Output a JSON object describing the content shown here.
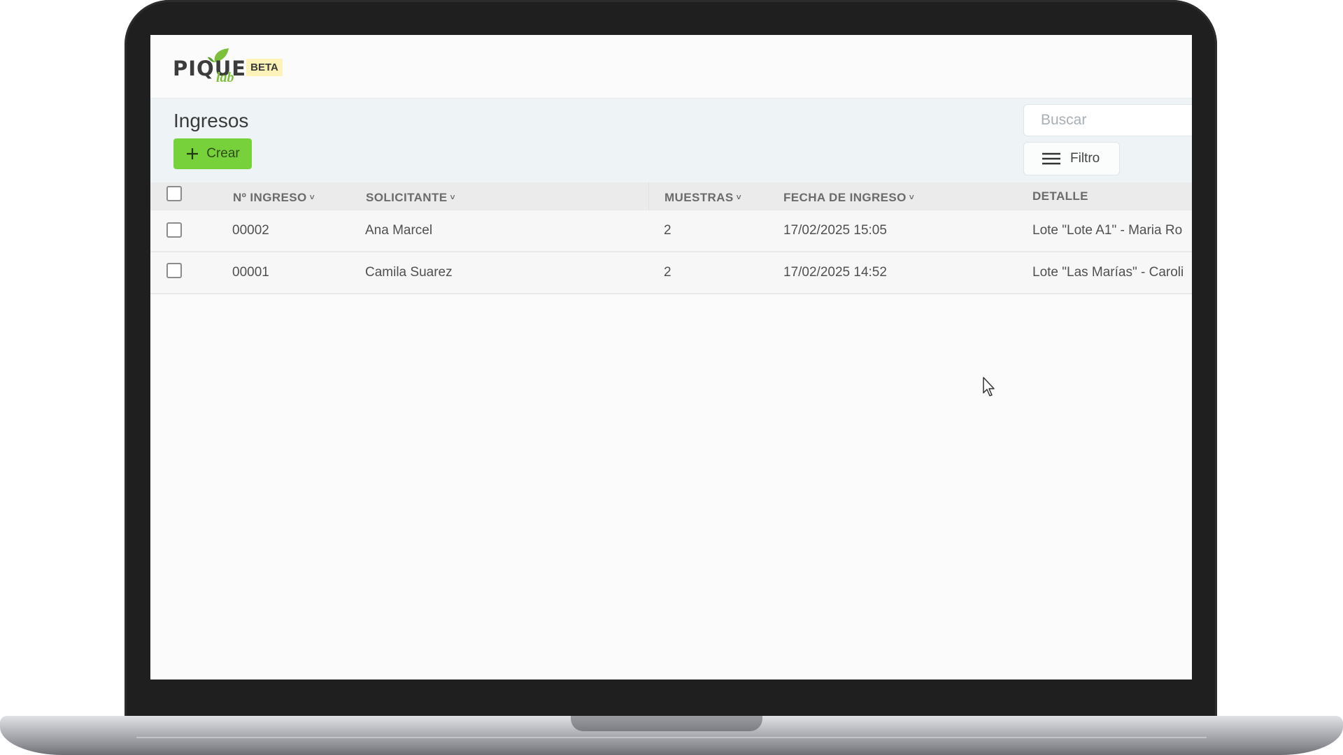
{
  "app": {
    "logo_text": "PIQUE",
    "logo_sub": "lab",
    "badge": "BETA"
  },
  "page": {
    "title": "Ingresos",
    "create_label": "Crear",
    "search_placeholder": "Buscar",
    "filter_label": "Filtro"
  },
  "table": {
    "columns": [
      {
        "label": "Nº INGRESO",
        "sortable": true
      },
      {
        "label": "SOLICITANTE",
        "sortable": true
      },
      {
        "label": "MUESTRAS",
        "sortable": true
      },
      {
        "label": "FECHA DE INGRESO",
        "sortable": true
      },
      {
        "label": "DETALLE",
        "sortable": false
      }
    ],
    "rows": [
      {
        "numero": "00002",
        "solicitante": "Ana Marcel",
        "muestras": "2",
        "fecha": "17/02/2025 15:05",
        "detalle": "Lote \"Lote A1\" - Maria Ro"
      },
      {
        "numero": "00001",
        "solicitante": "Camila Suarez",
        "muestras": "2",
        "fecha": "17/02/2025 14:52",
        "detalle": "Lote \"Las Marías\" - Caroli"
      }
    ]
  },
  "colors": {
    "accent_green": "#76d13b",
    "beta_badge_bg": "#fdf3b9",
    "toolbar_bg": "#eef3f6"
  },
  "icons": {
    "create": "plus-icon",
    "filter": "menu-lines-icon",
    "sort": "chevron-down-icon",
    "logo": "leaf-icon",
    "pointer": "mouse-cursor-icon"
  }
}
